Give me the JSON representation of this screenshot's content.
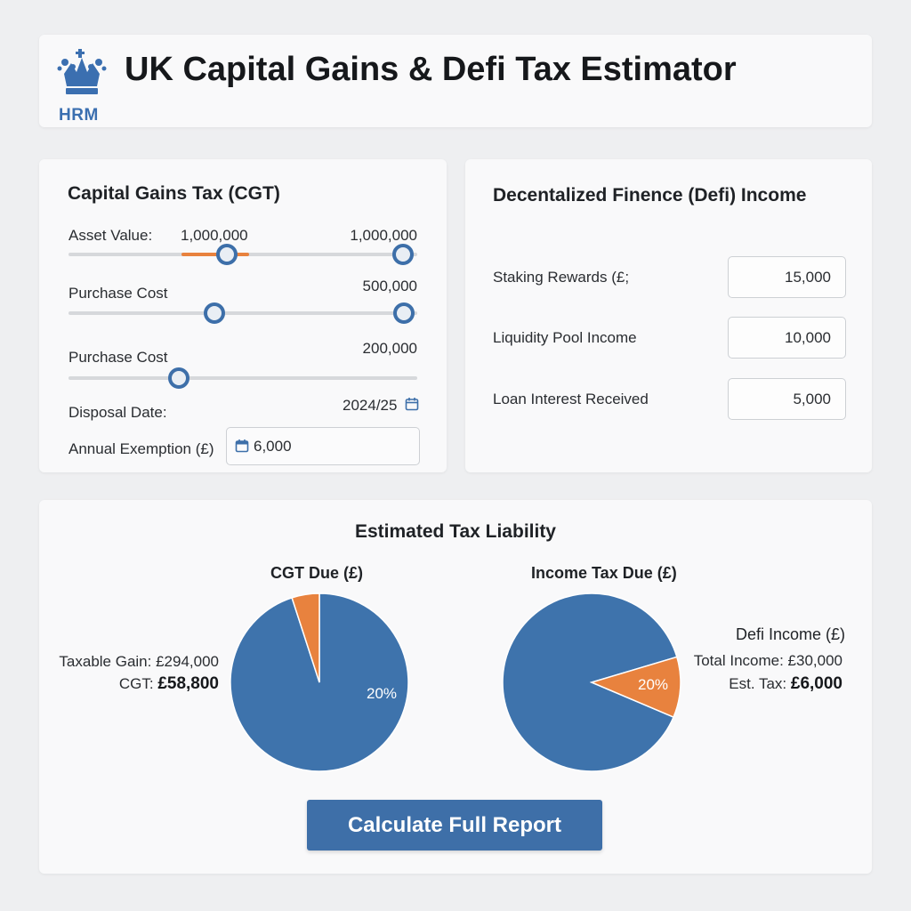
{
  "header": {
    "logo_text": "HRM",
    "title": "UK Capital Gains & Defi Tax Estimator"
  },
  "cgt": {
    "title": "Capital Gains Tax (CGT)",
    "asset_value": {
      "label": "Asset Value:",
      "value_left": "1,000,000",
      "value_right": "1,000,000"
    },
    "purchase_cost_1": {
      "label": "Purchase Cost",
      "value": "500,000"
    },
    "purchase_cost_2": {
      "label": "Purchase Cost",
      "value": "200,000"
    },
    "disposal_date": {
      "label": "Disposal Date:",
      "value": "2024/25"
    },
    "annual_exemption": {
      "label": "Annual Exemption (£)",
      "value": "6,000"
    }
  },
  "defi": {
    "title": "Decentalized Finence (Defi) Income",
    "fields": [
      {
        "label": "Staking Rewards (£;",
        "value": "15,000"
      },
      {
        "label": "Liquidity Pool Income",
        "value": "10,000"
      },
      {
        "label": "Loan Interest Received",
        "value": "5,000"
      }
    ]
  },
  "results": {
    "title": "Estimated Tax Liability",
    "cgt_pie": {
      "title": "CGT Due (£)",
      "slice_label": "20%",
      "taxable_gain_line": "Taxable Gain: £294,000",
      "cgt_prefix": "CGT: ",
      "cgt_value": "£58,800"
    },
    "income_pie": {
      "title": "Income Tax Due (£)",
      "legend_title": "Defi Income (£)",
      "slice_label": "20%",
      "total_income_line": "Total Income: £30,000",
      "est_tax_prefix": "Est. Tax: ",
      "est_tax_value": "£6,000"
    },
    "calculate_label": "Calculate Full Report"
  },
  "colors": {
    "primary_blue": "#3e6fa8",
    "accent_orange": "#e8823e"
  },
  "chart_data": [
    {
      "type": "pie",
      "title": "CGT Due (£)",
      "categories": [
        "",
        ""
      ],
      "values": [
        95,
        5
      ],
      "colors": [
        "#3e73ac",
        "#e8823e"
      ],
      "data_labels": [
        "20%",
        ""
      ]
    },
    {
      "type": "pie",
      "title": "Income Tax Due (£)",
      "categories": [
        "",
        ""
      ],
      "values": [
        89,
        11
      ],
      "colors": [
        "#3e73ac",
        "#e8823e"
      ],
      "data_labels": [
        "",
        "20%"
      ]
    }
  ]
}
